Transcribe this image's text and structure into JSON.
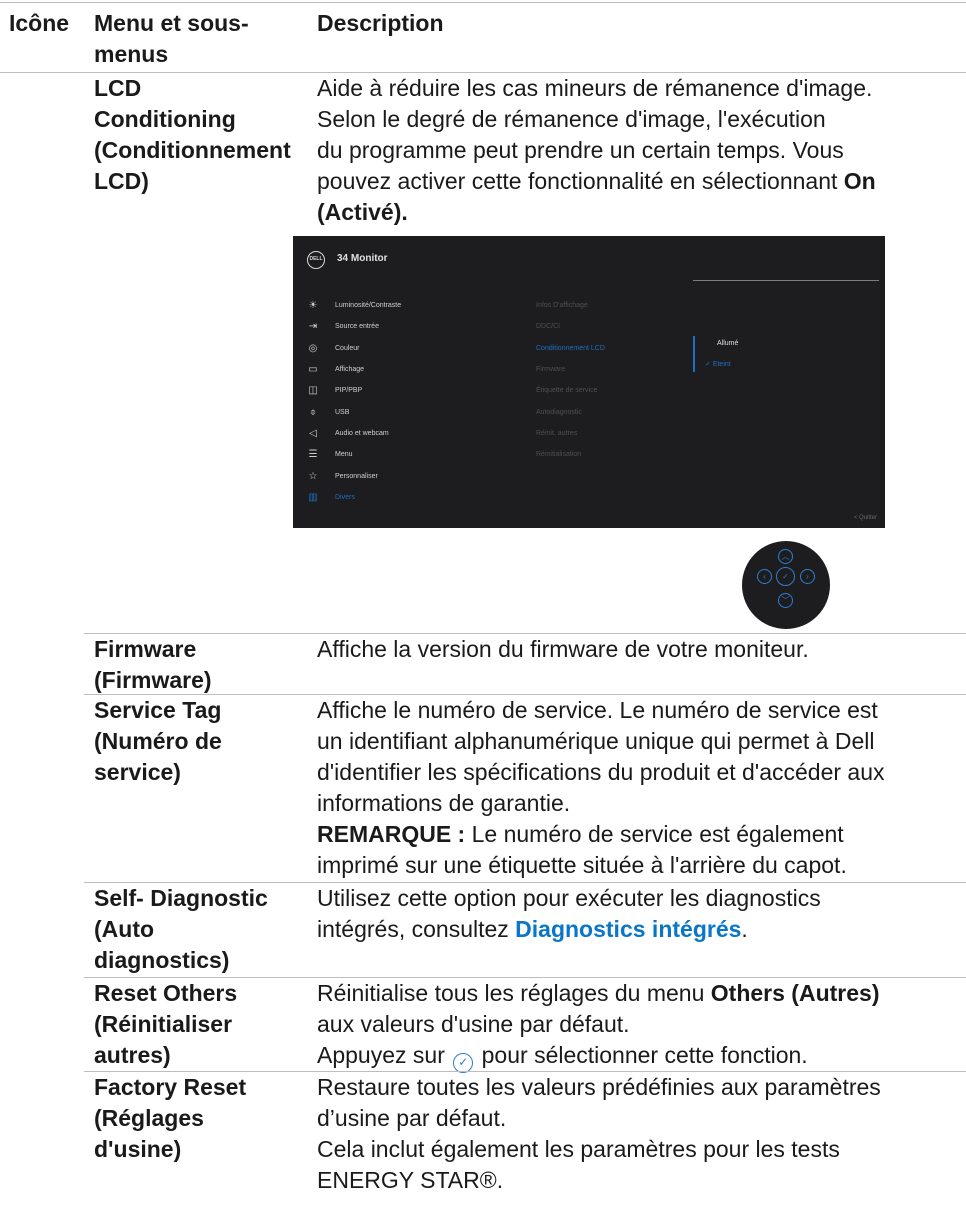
{
  "header": {
    "col_icon": "Icône",
    "col_menu": "Menu et sous-menus",
    "col_desc": "Description"
  },
  "rows": {
    "lcd": {
      "name_l1": "LCD",
      "name_l2": "Conditioning",
      "name_l3": "(Conditionnement",
      "name_l4": "LCD)",
      "desc_l1": "Aide à réduire les cas mineurs de rémanence d'image.",
      "desc_l2": "Selon le degré de rémanence d'image, l'exécution",
      "desc_l3": "du programme peut prendre un certain temps. Vous",
      "desc_l4_pre": "pouvez activer cette fonctionnalité en sélectionnant ",
      "desc_l4_bold": "On",
      "desc_l5_bold": "(Activé)."
    },
    "firmware": {
      "name_l1": "Firmware",
      "name_l2": "(Firmware)",
      "desc": "Affiche la version du firmware de votre moniteur."
    },
    "service": {
      "name_l1": "Service Tag",
      "name_l2": "(Numéro de",
      "name_l3": "service)",
      "desc_l1": "Affiche le numéro de service. Le numéro de service est",
      "desc_l2": "un identifiant alphanumérique unique qui permet à Dell",
      "desc_l3": "d'identifier les spécifications du produit et d'accéder aux",
      "desc_l4": "informations de garantie.",
      "note_bold": "REMARQUE :",
      "note_l1": " Le numéro de service est également",
      "note_l2": "imprimé sur une étiquette située à l'arrière du capot."
    },
    "selfdiag": {
      "name_l1": "Self- Diagnostic",
      "name_l2": "(Auto",
      "name_l3": "diagnostics)",
      "desc_l1": "Utilisez cette option pour exécuter les diagnostics",
      "desc_l2_pre": "intégrés, consultez ",
      "desc_l2_link": "Diagnostics intégrés",
      "desc_l2_post": "."
    },
    "resetothers": {
      "name_l1": "Reset Others",
      "name_l2": "(Réinitialiser",
      "name_l3": "autres)",
      "desc_l1_pre": "Réinitialise tous les réglages du menu ",
      "desc_l1_bold": "Others (Autres)",
      "desc_l2": "aux valeurs d'usine par défaut.",
      "desc_l3_pre": "Appuyez sur ",
      "desc_l3_post": " pour sélectionner cette fonction."
    },
    "factory": {
      "name_l1": "Factory Reset",
      "name_l2": "(Réglages",
      "name_l3": "d'usine)",
      "desc_l1": "Restaure toutes les valeurs prédéfinies aux paramètres",
      "desc_l2": "d’usine par défaut.",
      "desc_l3": "Cela inclut également les paramètres pour les tests",
      "desc_l4": "ENERGY STAR®."
    }
  },
  "osd": {
    "logo": "DELL",
    "title": "34 Monitor",
    "menu": [
      {
        "label": "Luminosité/Contraste",
        "icon": "brightness-icon"
      },
      {
        "label": "Source entrée",
        "icon": "input-source-icon"
      },
      {
        "label": "Couleur",
        "icon": "color-icon"
      },
      {
        "label": "Affichage",
        "icon": "display-icon"
      },
      {
        "label": "PIP/PBP",
        "icon": "pip-pbp-icon"
      },
      {
        "label": "USB",
        "icon": "usb-icon"
      },
      {
        "label": "Audio et webcam",
        "icon": "audio-icon"
      },
      {
        "label": "Menu",
        "icon": "menu-icon"
      },
      {
        "label": "Personnaliser",
        "icon": "star-icon"
      },
      {
        "label": "Divers",
        "icon": "others-icon"
      }
    ],
    "submenu": [
      "Infos D'affichage",
      "DDC/CI",
      "Conditionnement LCD",
      "Firmware",
      "Étiquette de service",
      "Autodiagnostic",
      "Réinit. autres",
      "Réinitialisation"
    ],
    "option_on": "Allumé",
    "option_off": "Eteint",
    "quit": "< Quitter",
    "accent": "#1d6fc4"
  }
}
